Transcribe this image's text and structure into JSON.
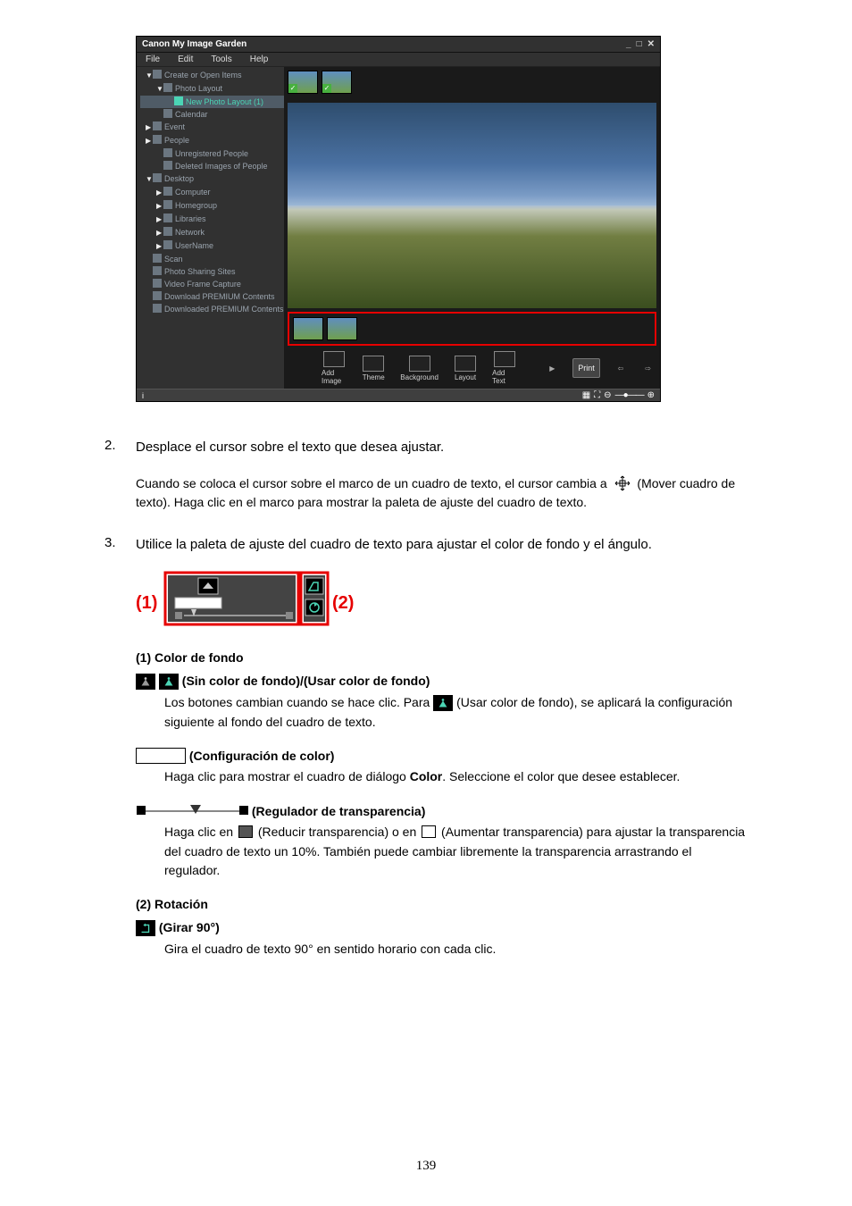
{
  "page_number": "139",
  "app": {
    "title": "Canon My Image Garden",
    "menu": [
      "File",
      "Edit",
      "Tools",
      "Help"
    ],
    "tree": [
      {
        "lvl": 1,
        "tri": "▼",
        "icon": "create-icon",
        "label": "Create or Open Items"
      },
      {
        "lvl": 2,
        "tri": "▼",
        "icon": "layout-icon",
        "label": "Photo Layout"
      },
      {
        "lvl": 3,
        "tri": "",
        "icon": "layout-icon",
        "label": "New Photo Layout (1)",
        "sel": true
      },
      {
        "lvl": 2,
        "tri": "",
        "icon": "calendar-icon",
        "label": "Calendar"
      },
      {
        "lvl": 1,
        "tri": "▶",
        "icon": "event-icon",
        "label": "Event"
      },
      {
        "lvl": 1,
        "tri": "▶",
        "icon": "people-icon",
        "label": "People"
      },
      {
        "lvl": 2,
        "tri": "",
        "icon": "people-icon",
        "label": "Unregistered People"
      },
      {
        "lvl": 2,
        "tri": "",
        "icon": "trash-icon",
        "label": "Deleted Images of People"
      },
      {
        "lvl": 1,
        "tri": "▼",
        "icon": "desktop-icon",
        "label": "Desktop"
      },
      {
        "lvl": 2,
        "tri": "▶",
        "icon": "computer-icon",
        "label": "Computer"
      },
      {
        "lvl": 2,
        "tri": "▶",
        "icon": "homegroup-icon",
        "label": "Homegroup"
      },
      {
        "lvl": 2,
        "tri": "▶",
        "icon": "libraries-icon",
        "label": "Libraries"
      },
      {
        "lvl": 2,
        "tri": "▶",
        "icon": "network-icon",
        "label": "Network"
      },
      {
        "lvl": 2,
        "tri": "▶",
        "icon": "user-icon",
        "label": "UserName"
      },
      {
        "lvl": 1,
        "tri": "",
        "icon": "scan-icon",
        "label": "Scan"
      },
      {
        "lvl": 1,
        "tri": "",
        "icon": "share-icon",
        "label": "Photo Sharing Sites"
      },
      {
        "lvl": 1,
        "tri": "",
        "icon": "video-icon",
        "label": "Video Frame Capture"
      },
      {
        "lvl": 1,
        "tri": "",
        "icon": "download-icon",
        "label": "Download PREMIUM Contents"
      },
      {
        "lvl": 1,
        "tri": "",
        "icon": "downloaded-icon",
        "label": "Downloaded PREMIUM Contents"
      }
    ],
    "toolbar": [
      "Add Image",
      "Theme",
      "Background",
      "Layout",
      "Add Text"
    ],
    "print": "Print"
  },
  "step2": {
    "number": "2.",
    "title": "Desplace el cursor sobre el texto que desea ajustar.",
    "body_pre": "Cuando se coloca el cursor sobre el marco de un cuadro de texto, el cursor cambia a ",
    "body_post": " (Mover cuadro de texto). Haga clic en el marco para mostrar la paleta de ajuste del cuadro de texto."
  },
  "step3": {
    "number": "3.",
    "title": "Utilice la paleta de ajuste del cuadro de texto para ajustar el color de fondo y el ángulo.",
    "label1": "(1)",
    "label2": "(2)"
  },
  "sec1": {
    "title": "(1) Color de fondo",
    "a": {
      "head": "(Sin color de fondo)/(Usar color de fondo)",
      "desc_pre": "Los botones cambian cuando se hace clic. Para ",
      "desc_post": " (Usar color de fondo), se aplicará la configuración siguiente al fondo del cuadro de texto."
    },
    "b": {
      "head": " (Configuración de color)",
      "desc_pre": "Haga clic para mostrar el cuadro de diálogo ",
      "desc_bold": "Color",
      "desc_post": ". Seleccione el color que desee establecer."
    },
    "c": {
      "head": " (Regulador de transparencia)",
      "desc_a": "Haga clic en ",
      "desc_b": " (Reducir transparencia) o en ",
      "desc_c": " (Aumentar transparencia) para ajustar la transparencia del cuadro de texto un 10%. También puede cambiar libremente la transparencia arrastrando el regulador."
    }
  },
  "sec2": {
    "title": "(2) Rotación",
    "a": {
      "head": " (Girar 90°)",
      "desc": "Gira el cuadro de texto 90° en sentido horario con cada clic."
    }
  }
}
